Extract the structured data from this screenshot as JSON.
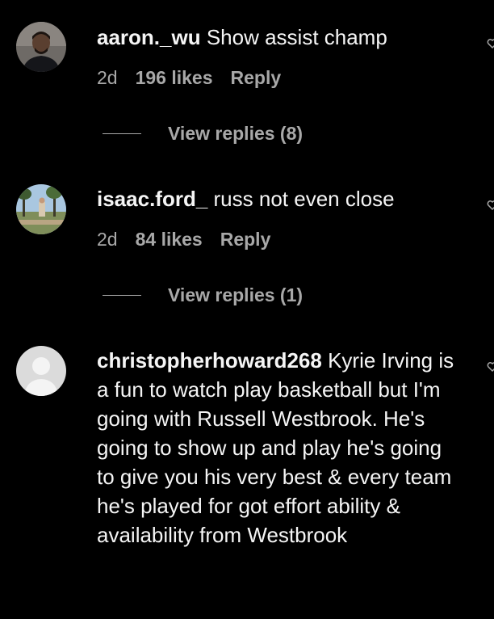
{
  "comments": [
    {
      "username": "aaron._wu",
      "text": " Show assist champ",
      "time": "2d",
      "likes": "196 likes",
      "reply_label": "Reply",
      "replies_label": "View replies (8)"
    },
    {
      "username": "isaac.ford_",
      "text": " russ not even close",
      "time": "2d",
      "likes": "84 likes",
      "reply_label": "Reply",
      "replies_label": "View replies (1)"
    },
    {
      "username": "christopherhoward268",
      "text": " Kyrie Irving is a fun to watch play basketball but I'm going with Russell Westbrook. He's going to show up and play he's going to give you his very best & every team he's played for got effort ability & availability from Westbrook"
    }
  ],
  "colors": {
    "background": "#000000",
    "primary_text": "#f5f5f5",
    "secondary_text": "#a8a8a8"
  },
  "icons": [
    "heart-icon",
    "default-avatar-icon"
  ]
}
